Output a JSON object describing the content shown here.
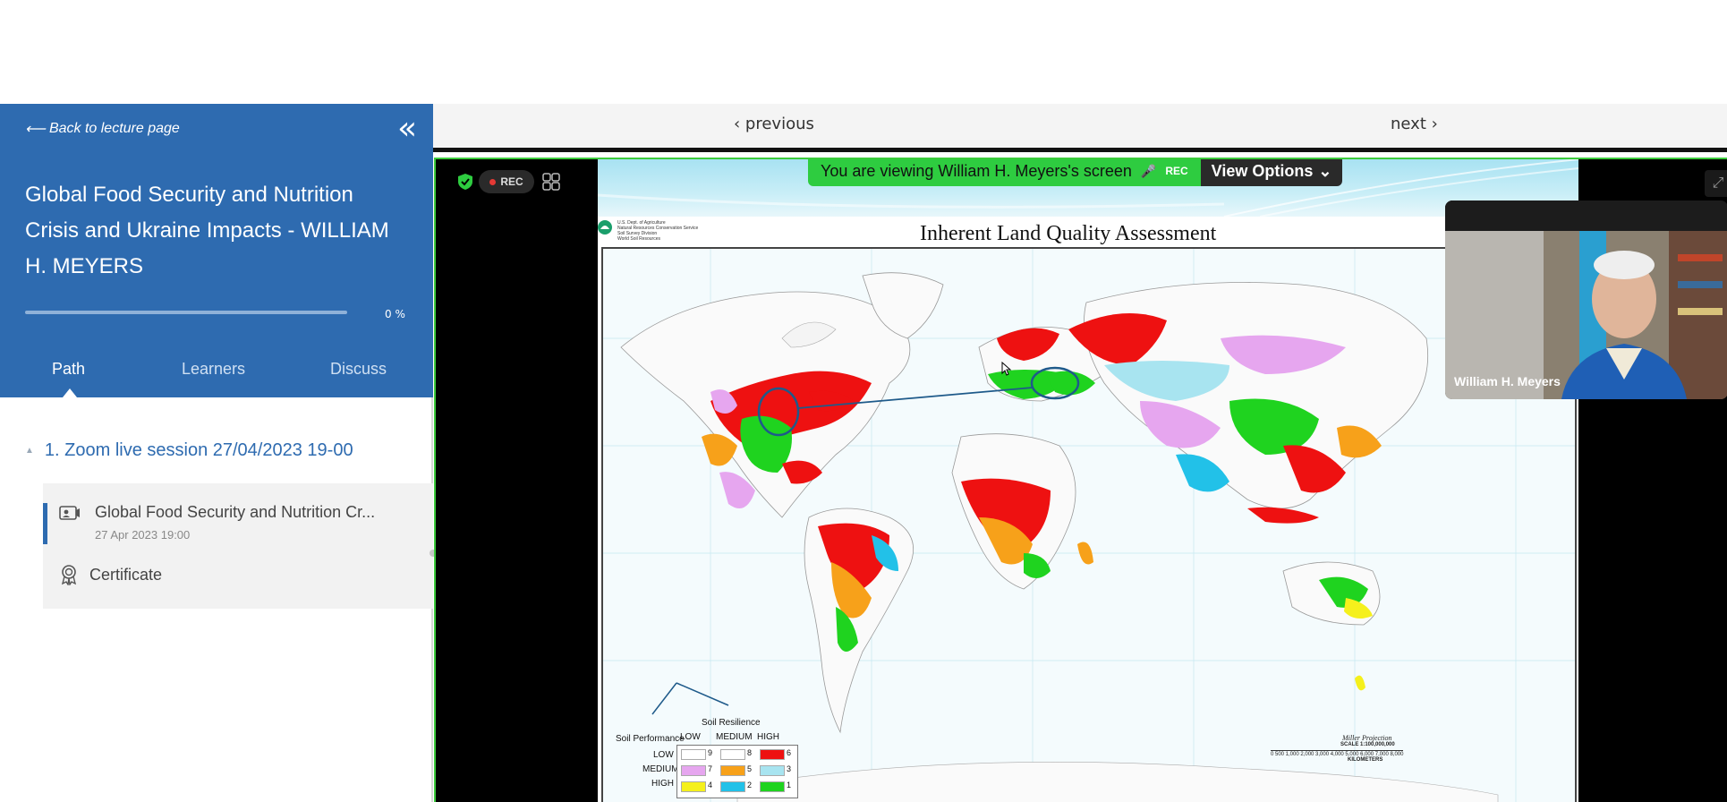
{
  "sidebar": {
    "back_label": "Back to lecture page",
    "course_title": "Global Food Security and Nutrition Crisis and Ukraine Impacts - WILLIAM H. MEYERS",
    "progress": {
      "percent_label": "0 %",
      "fraction": 0.0
    },
    "tabs": [
      {
        "label": "Path",
        "active": true
      },
      {
        "label": "Learners",
        "active": false
      },
      {
        "label": "Discuss",
        "active": false
      }
    ],
    "section": {
      "label": "1. Zoom live session 27/04/2023 19-00"
    },
    "lesson": {
      "title": "Global Food Security and Nutrition Cr...",
      "date": "27 Apr 2023 19:00"
    },
    "certificate": {
      "label": "Certificate"
    }
  },
  "nav": {
    "previous": "previous",
    "next": "next"
  },
  "zoom": {
    "rec_label": "REC",
    "share_banner": "You are viewing William H. Meyers's screen",
    "share_rec": "REC",
    "view_options": "View Options",
    "participant_name": "William H. Meyers"
  },
  "slide": {
    "agency": [
      "U.S. Dept. of Agriculture",
      "Natural Resources Conservation Service",
      "Soil Survey Division",
      "World Soil Resources"
    ],
    "title": "Inherent Land Quality Assessment",
    "legend": {
      "resilience_label": "Soil Resilience",
      "performance_label": "Soil Performance",
      "col_headers": [
        "LOW",
        "MEDIUM",
        "HIGH"
      ],
      "row_headers": [
        "LOW",
        "MEDIUM",
        "HIGH"
      ],
      "cells": [
        [
          {
            "n": "9",
            "color": "#ffffff"
          },
          {
            "n": "8",
            "color": "#ffffff"
          },
          {
            "n": "6",
            "color": "#ee1111"
          }
        ],
        [
          {
            "n": "7",
            "color": "#e6a6ef"
          },
          {
            "n": "5",
            "color": "#f7a11a"
          },
          {
            "n": "3",
            "color": "#a8e4f0"
          }
        ],
        [
          {
            "n": "4",
            "color": "#f5f01c"
          },
          {
            "n": "2",
            "color": "#22c1e8"
          },
          {
            "n": "1",
            "color": "#1fd31f"
          }
        ]
      ]
    },
    "projection": "Miller Projection",
    "scale": "SCALE 1:100,000,000",
    "scale_ticks": "0   500 1,000   2,000   3,000   4,000   5,000   6,000   7,000   8,000",
    "scale_unit": "KILOMETERS"
  },
  "colors": {
    "brand_blue": "#2e6bb0",
    "zoom_green": "#2ecc40",
    "high": "#ee1111",
    "best": "#1fd31f"
  }
}
